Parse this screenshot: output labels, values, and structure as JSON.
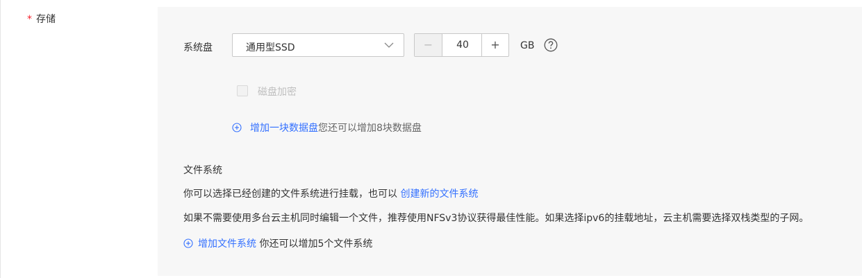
{
  "storage": {
    "required_mark": "*",
    "label": "存储"
  },
  "system_disk": {
    "label": "系统盘",
    "type_value": "通用型SSD",
    "size_value": "40",
    "minus": "−",
    "plus": "+",
    "unit": "GB"
  },
  "encryption": {
    "label": "磁盘加密",
    "checked": false
  },
  "data_disk": {
    "add_link": "增加一块数据盘",
    "hint": "您还可以增加8块数据盘"
  },
  "file_system": {
    "title": "文件系统",
    "line1_text": "你可以选择已经创建的文件系统进行挂载，也可以",
    "line1_link": "创建新的文件系统",
    "line2": "如果不需要使用多台云主机同时编辑一个文件，推荐使用NFSv3协议获得最佳性能。如果选择ipv6的挂载地址，云主机需要选择双栈类型的子网。",
    "add_link": "增加文件系统",
    "hint": "你还可以增加5个文件系统"
  },
  "colors": {
    "accent": "#3370ff",
    "required": "#f5222d",
    "panel_bg": "#f7f7f7"
  }
}
